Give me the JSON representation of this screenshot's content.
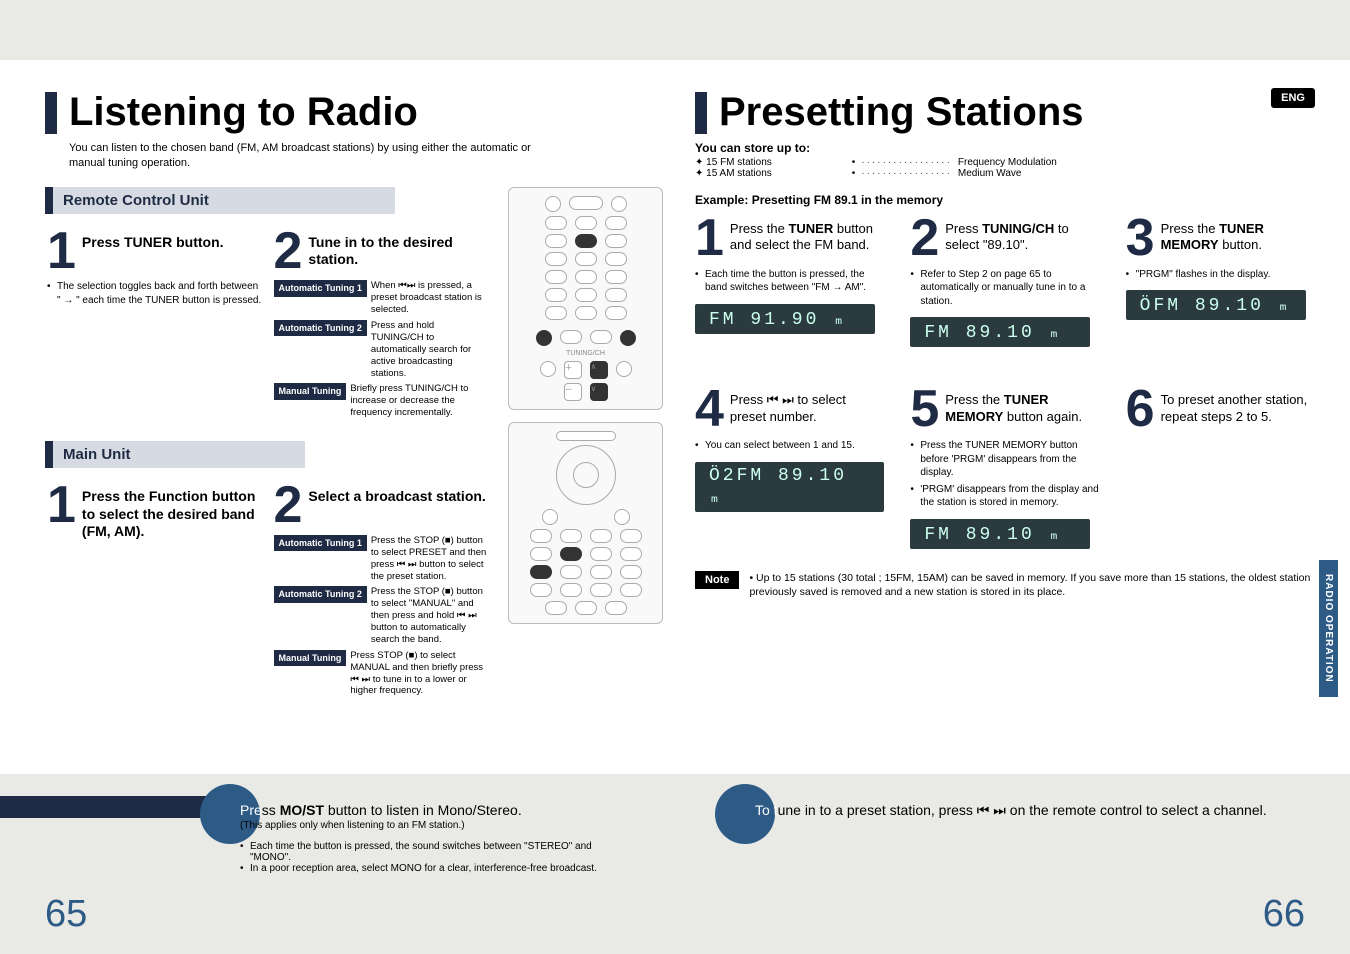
{
  "lang_badge": "ENG",
  "side_tab": "RADIO OPERATION",
  "page_left_num": "65",
  "page_right_num": "66",
  "left": {
    "title": "Listening to Radio",
    "subtitle": "You can listen to the chosen band (FM, AM broadcast stations) by using either the automatic or manual tuning operation.",
    "section_remote": "Remote Control Unit",
    "section_main": "Main Unit",
    "remote_step1": {
      "num": "1",
      "head": "Press TUNER button.",
      "bullets": [
        "The selection toggles back and forth between \"        →        \" each time the TUNER button is pressed."
      ]
    },
    "remote_step2": {
      "num": "2",
      "head": "Tune in to the desired station.",
      "tags": [
        {
          "label": "Automatic Tuning 1",
          "text": "When ⏮⏭ is pressed, a preset broadcast station is selected."
        },
        {
          "label": "Automatic Tuning 2",
          "text": "Press and hold TUNING/CH to automatically search for active broadcasting stations."
        },
        {
          "label": "Manual Tuning",
          "text": "Briefly press TUNING/CH to increase or decrease the frequency incrementally."
        }
      ]
    },
    "main_step1": {
      "num": "1",
      "head": "Press the Function button to select the desired band (FM, AM)."
    },
    "main_step2": {
      "num": "2",
      "head": "Select a broadcast station.",
      "tags": [
        {
          "label": "Automatic Tuning 1",
          "text": "Press the STOP (■) button to select PRESET and then press ⏮ ⏭ button to select the preset station."
        },
        {
          "label": "Automatic Tuning 2",
          "text": "Press the STOP (■) button to select \"MANUAL\" and then press and hold ⏮ ⏭ button to automatically search the band."
        },
        {
          "label": "Manual Tuning",
          "text": "Press STOP (■) to select MANUAL and then briefly press ⏮ ⏭ to tune in to a lower or higher frequency."
        }
      ]
    }
  },
  "right": {
    "title": "Presetting Stations",
    "store_title": "You can store up to:",
    "store_items": [
      "15 FM stations",
      "15 AM stations"
    ],
    "legend_items": [
      "Frequency Modulation",
      "Medium Wave"
    ],
    "example": "Example: Presetting FM 89.1 in the memory",
    "steps": [
      {
        "num": "1",
        "head_parts": [
          "Press the ",
          "TUNER",
          " button and select the FM band."
        ],
        "bullets": [
          "Each time the button is pressed, the band switches between \"FM → AM\"."
        ],
        "lcd": "FM 91.90 ₘ"
      },
      {
        "num": "2",
        "head_parts": [
          "Press ",
          "TUNING/CH",
          " to select \"89.10\"."
        ],
        "bullets": [
          "Refer to Step 2 on page 65 to automatically or manually tune in to a station."
        ],
        "lcd": "FM 89.10 ₘ"
      },
      {
        "num": "3",
        "head_parts": [
          "Press the ",
          "TUNER MEMORY",
          " button."
        ],
        "bullets": [
          "\"PRGM\" flashes in the display."
        ],
        "lcd": "ÖFM 89.10 ₘ"
      },
      {
        "num": "4",
        "head_parts": [
          "Press ⏮ ⏭ to select preset number."
        ],
        "bullets": [
          "You can select between 1 and 15."
        ],
        "lcd": "Ö2FM 89.10 ₘ"
      },
      {
        "num": "5",
        "head_parts": [
          "Press the ",
          "TUNER MEMORY",
          " button again."
        ],
        "bullets": [
          "Press the TUNER MEMORY button before 'PRGM' disappears from the display.",
          "'PRGM' disappears from the display and the station is stored in memory."
        ],
        "lcd": "FM 89.10 ₘ"
      },
      {
        "num": "6",
        "head_parts": [
          "To preset another station, repeat steps 2 to 5."
        ],
        "bullets": [],
        "lcd": ""
      }
    ],
    "note_label": "Note",
    "note_text": "Up to 15 stations (30 total ; 15FM, 15AM) can be saved in memory. If you save more than 15 stations, the oldest station previously saved is removed and a new station is stored in its place."
  },
  "bottom": {
    "left_tip_lead_white": "Pre",
    "left_tip_lead_rest": "ss ",
    "left_tip_head": "MO/ST button to listen in Mono/Stereo.",
    "left_tip_sub": "(This applies only when listening to an FM station.)",
    "left_tip_list": [
      "Each time the button is pressed, the sound switches between \"STEREO\" and \"MONO\".",
      "In a poor reception area, select MONO for a clear, interference-free broadcast."
    ],
    "right_tip_lead_white": "To t",
    "right_tip_lead_rest": "une in to a preset station, press  ⏮ ⏭  on the remote control to select a channel."
  }
}
